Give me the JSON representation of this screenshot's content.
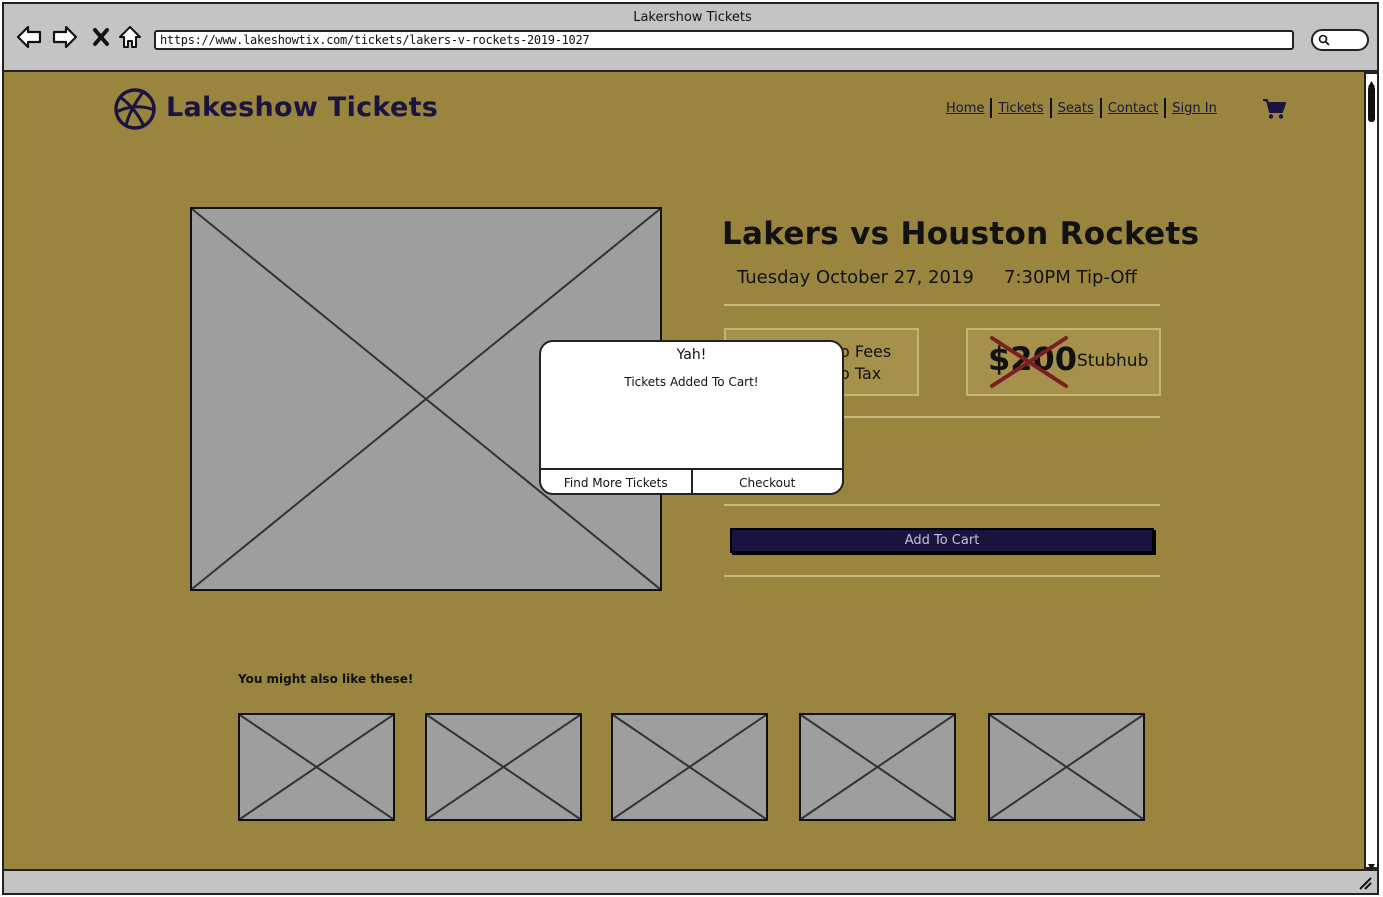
{
  "browser": {
    "window_title": "Lakershow Tickets",
    "url": "https://www.lakeshowtix.com/tickets/lakers-v-rockets-2019-1027"
  },
  "header": {
    "brand": "Lakeshow Tickets",
    "nav": [
      "Home",
      "Tickets",
      "Seats",
      "Contact",
      "Sign In"
    ]
  },
  "event": {
    "title": "Lakers vs Houston Rockets",
    "date": "Tuesday October 27, 2019",
    "time": "7:30PM Tip-Off"
  },
  "pricing": {
    "fees_line1": "o Fees",
    "fees_line2": "o Tax",
    "old_price": "$200",
    "vendor": "Stubhub"
  },
  "actions": {
    "add_to_cart": "Add To Cart"
  },
  "modal": {
    "title": "Yah!",
    "message": "Tickets Added To Cart!",
    "left_button": "Find More Tickets",
    "right_button": "Checkout"
  },
  "recommendations": {
    "label": "You might also like these!",
    "count": 5
  },
  "colors": {
    "page_bg": "#9a853e",
    "brand": "#1b1340",
    "chrome": "#c4c4c4"
  }
}
